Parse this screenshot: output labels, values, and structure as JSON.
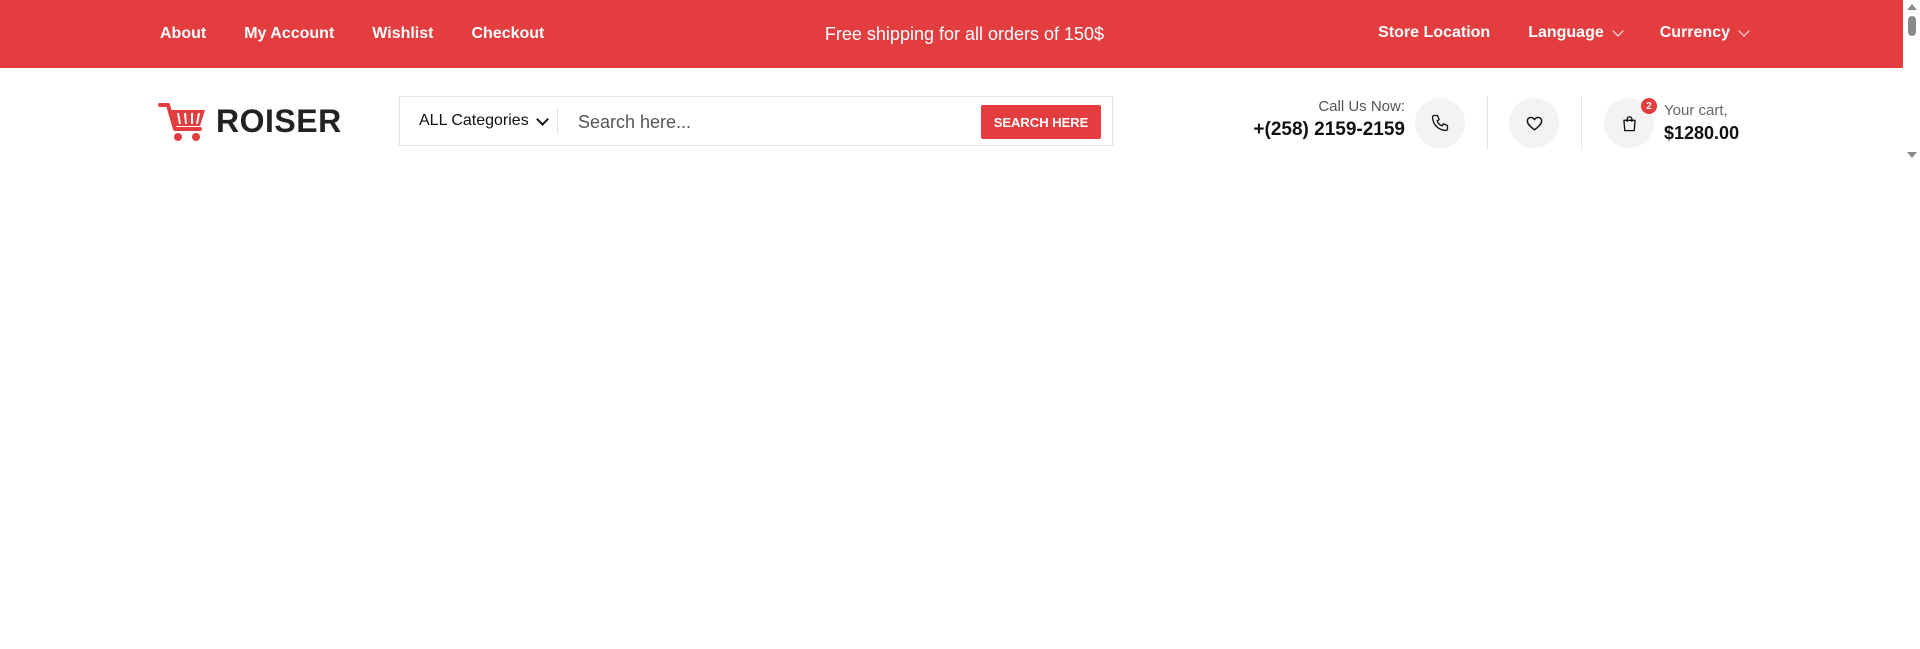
{
  "colors": {
    "accent": "#e43d40",
    "topbar_text": "#ffffff"
  },
  "topbar": {
    "left_links": [
      "About",
      "My Account",
      "Wishlist",
      "Checkout"
    ],
    "promo": "Free shipping for all orders of 150$",
    "right_links": [
      {
        "label": "Store Location",
        "has_dropdown": false
      },
      {
        "label": "Language",
        "has_dropdown": true
      },
      {
        "label": "Currency",
        "has_dropdown": true
      }
    ]
  },
  "header": {
    "logo_text": "ROISER",
    "logo_icon": "shopping-cart-icon",
    "search": {
      "category_label": "ALL Categories",
      "placeholder": "Search here...",
      "button_label": "SEARCH HERE"
    },
    "contact": {
      "label": "Call Us Now:",
      "phone": "+(258) 2159-2159",
      "icon": "phone-icon"
    },
    "wishlist_icon": "heart-icon",
    "cart": {
      "icon": "shopping-bag-icon",
      "count": "2",
      "label": "Your cart,",
      "total": "$1280.00"
    }
  }
}
